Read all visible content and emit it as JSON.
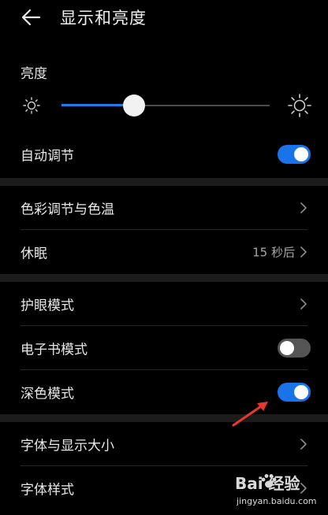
{
  "header": {
    "title": "显示和亮度"
  },
  "brightness": {
    "label": "亮度",
    "level": 0.35
  },
  "rows": {
    "auto_adjust": {
      "label": "自动调节",
      "toggle": "on"
    },
    "color_temp": {
      "label": "色彩调节与色温"
    },
    "sleep": {
      "label": "休眠",
      "value": "15 秒后"
    },
    "eye_comfort": {
      "label": "护眼模式"
    },
    "ebook_mode": {
      "label": "电子书模式",
      "toggle": "off"
    },
    "dark_mode": {
      "label": "深色模式",
      "toggle": "on"
    },
    "font_size": {
      "label": "字体与显示大小"
    },
    "font_style": {
      "label": "字体样式"
    }
  },
  "colors": {
    "accent": "#1a73e8",
    "background": "#000000",
    "section_gap": "#1c1c1c",
    "annotation": "#e8372c"
  },
  "icons": {
    "back": "arrow-left-icon",
    "sun_small": "sun-dim-icon",
    "sun_large": "sun-bright-icon",
    "chevron": "chevron-right-icon"
  },
  "watermark": {
    "brand": "Bai  经验",
    "sub": "jingyan.baidu.com"
  }
}
